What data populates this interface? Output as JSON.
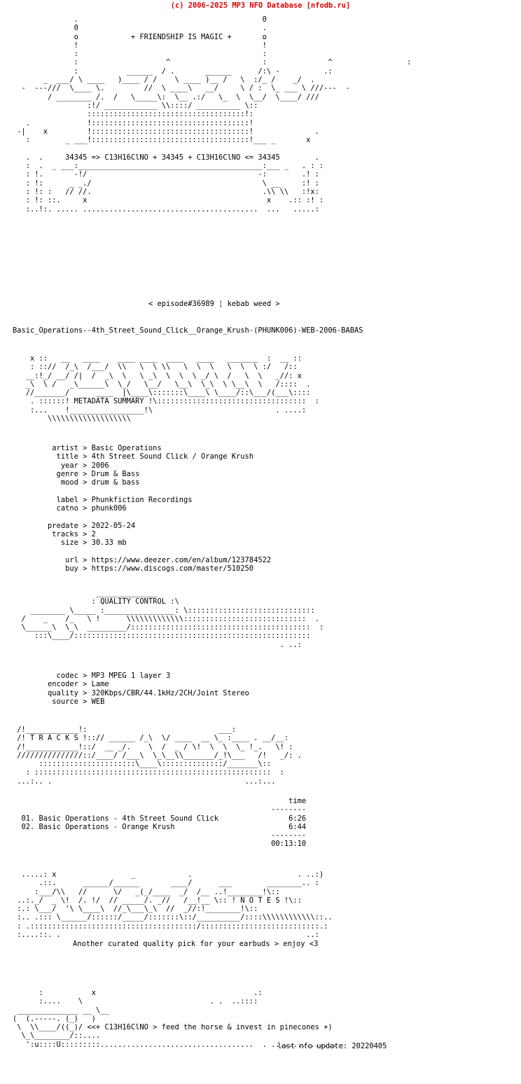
{
  "page": {
    "copyright": "(c) 2006-2025 MP3 NFO Database [nfodb.ru]",
    "copyright_color": "#e00000",
    "background_color": "#ffffff",
    "text_color": "#000000"
  },
  "header": {
    "tagline": "+ FRIENDSHIP IS MAGIC +",
    "formula_line": "34345 => C13H16ClNO + 34345 + C13H16ClNO <= 34345",
    "episode_line": "< episode#36989 ¦ kebab weed >",
    "release_name": "Basic_Operations--4th_Street_Sound_Click__Orange_Krush-(PHUNK006)-WEB-2006-BABAS",
    "ascii_art": "              .                                          0\n              0                                          .\n              o            + FRIENDSHIP IS MAGIC +       o\n              !                                          !\n              :                                          :\n              :                    ^                     :              ^                 :\n              :           ______  / .       ______      /:\\ -          .:\n       _  ___/ \\ ____   )____ / /    \\ ____ )__ /   \\  :/_ /    _/  .\n  -  ---///  \\____ \\.         //  \\ ____\\   __/     \\ / :  \\_ ___ \\ ///---  -\n        / ________ /.  /   \\_____\\:  \\__ .:/   \\_  \\  \\__/  \\____/ ///\n                 :!/ ____________ \\\\::::/ __________ \\::\n                 ::::::::::::::::::::::::::::::::::::!:\n   .             !::::::::::::::::::::::::::::::::::::!\n -|    x         !::::::::::::::::::::::::::::::::::::!              .\n   :        _ ___!::::::::::::::::::::::::::::::::::::!___ _       x\n\n   .  .     34345 => C13H16ClNO + 34345 + C13H16ClNO <= 34345        .\n   :  .  _ ___:__________________________________________:___ _   . : :\n   : !.       -!/                                       -:        .! :\n   : !:      _ _./                                       \\ __     :! :\n   : !: :   // //.                                       .\\\\ \\\\   :!x:\n   : !: ::.     x                                         x    .:: :! :\n   :..!:. ..... ........................................  ...   .....:"
  },
  "metadata_banner": {
    "label": "METADATA SUMMARY",
    "ascii_art": "    x ::   __   ____    ____ ____  ____   ____   _______  :  __ ::\n    : :://  /_\\  /___/  \\\\   \\  \\ \\\\   \\  \\  \\   \\  \\  \\ :/   /::\n   __:!_/ __/ /|  /  _\\  \\   \\ _\\  \\  \\  \\ _/ \\  /   \\  \\   _//: x\n   _\\  \\ /   _\\______\\  \\_/   \\__/   \\__\\  \\_\\  \\ \\__\\  \\   /::::  .\n   //_______/      ____  |\\____\\:::::::\\____\\ \\____/::\\___/(___\\::::\n    . ::::::! METADATA SUMMARY !\\::::::::::::::::::::::::::::::::::  :\n    :...    !_________________!\\                            . ....:\n        \\\\\\\\\\\\\\\\\\\\\\\\\\\\\\\\\\\\\\"
  },
  "metadata": {
    "fields": [
      {
        "key": "artist",
        "value": "Basic Operations"
      },
      {
        "key": "title",
        "value": "4th Street Sound Click / Orange Krush"
      },
      {
        "key": "year",
        "value": "2006"
      },
      {
        "key": "genre",
        "value": "Drum & Bass"
      },
      {
        "key": "mood",
        "value": "drum & bass"
      },
      {
        "key": "",
        "value": ""
      },
      {
        "key": "label",
        "value": "Phunkfiction Recordings"
      },
      {
        "key": "catno",
        "value": "phunk006"
      },
      {
        "key": "",
        "value": ""
      },
      {
        "key": "predate",
        "value": "2022-05-24"
      },
      {
        "key": "tracks",
        "value": "2"
      },
      {
        "key": "size",
        "value": "30.33 mb"
      },
      {
        "key": "",
        "value": ""
      },
      {
        "key": "url",
        "value": "https://www.deezer.com/en/album/123784522"
      },
      {
        "key": "buy",
        "value": "https://www.discogs.com/master/510250"
      }
    ],
    "rendered": "         artist > Basic Operations\n          title > 4th Street Sound Click / Orange Krush\n           year > 2006\n          genre > Drum & Bass\n           mood > drum & bass\n\n          label > Phunkfiction Recordings\n          catno > phunk006\n\n        predate > 2022-05-24\n         tracks > 2\n           size > 30.33 mb\n\n            url > https://www.deezer.com/en/album/123784522\n            buy > https://www.discogs.com/master/510250"
  },
  "quality_banner": {
    "label": "QUALITY CONTROL",
    "ascii_art": "                   ______________\n                  : QUALITY CONTROL :\\\n    ________ \\_____ :________________: \\:::::::::::::::::::::::::::::\n  /    _    /_   \\ !      \\\\\\\\\\\\\\\\\\\\\\\\\\::::::::::::::::::::::::::::  .\n  \\______\\  \\_\\  _________/:::::::::::::::::::::::::::::::::::::::::  :\n     :::\\____/::::::::::::::::::::::::::::::::::::::::::::::::::::::\n                                                             . ..:"
  },
  "quality": {
    "fields": [
      {
        "key": "codec",
        "value": "MP3 MPEG 1 layer 3"
      },
      {
        "key": "encoder",
        "value": "Lame"
      },
      {
        "key": "quality",
        "value": "320Kbps/CBR/44.1kHz/2CH/Joint Stereo"
      },
      {
        "key": "source",
        "value": "WEB"
      }
    ],
    "rendered": "          codec > MP3 MPEG 1 layer 3\n        encoder > Lame\n        quality > 320Kbps/CBR/44.1kHz/2CH/Joint Stereo\n         source > WEB"
  },
  "tracks_banner": {
    "label": "T R A C K S",
    "ascii_art": " /!____________!:                              ___:\n /! T R A C K S !::// ______ /_\\  \\/ ____  __ \\_ :____ . __/__:\n /!____________!::/  __ _/.    \\  /  _ / \\!  \\  \\  \\_ !_.   \\! :\n ///////////////::/____/ /___\\  \\_\\__\\\\_______/_!\\___   /!   _/: .\n      ::::::::::::::::::::::\\____\\::::::::::::::/_______\\::\n   : ::::::::::::::::::::::::::::::::::::::::::::::::::::::  :\n ...:.. .                                            ...:..."
  },
  "tracklist": {
    "time_header": "time",
    "divider": "--------",
    "items": [
      {
        "num": "01.",
        "artist": "Basic Operations",
        "title": "4th Street Sound Click",
        "time": "6:26"
      },
      {
        "num": "02.",
        "artist": "Basic Operations",
        "title": "Orange Krush",
        "time": "6:44"
      }
    ],
    "total_time": "00:13:10",
    "rendered": "                                                               time\n                                                           --------\n  01. Basic Operations - 4th Street Sound Click                6:26\n  02. Basic Operations - Orange Krush                          6:44\n                                                           --------\n                                                           00:13:10"
  },
  "notes_banner": {
    "label": "N O T E S",
    "ascii_art": "  .....: x                 _            .                        . ..:)\n      .::.      ______/______       ____/      ___        ________.. :\n     :___/\\\\   //      \\/   _(_/____  _/  /__ ..!________!\\::\n ..:._/  _ \\!  /. !/  // _____/. _//   /__!__ \\:: ! N O T E S !\\::\n :.: \\___/  '\\ \\____\\  //_\\___\\_\\  //  _//:!________!\\::\n :.. .::: \\______/::::::/_____/:::::::\\::/__________/::::\\\\\\\\\\\\\\\\\\\\\\\\::..\n : .::::::::::::::::::::::::::::::::::::::/:::::::::::::::::::::::::::.:\n :....::. .                                                        ..:",
    "note_text": "Another curated quality pick for your earbuds > enjoy <3"
  },
  "footer": {
    "signature_line": "<<+ C13H16ClNO > feed the horse & invest in pinecones +)",
    "last_update_label": "last nfo update:",
    "last_update_value": "20220405",
    "last_update_line": "last nfo update: 20220405",
    "ascii_art": "      :           x                                    .:\n      :....    \\                             . .  ..::::\n ______________ __ \\__\n(  (.-----. (_)   )\n \\  \\\\____/((_)/ <<+ C13H16ClNO > feed the horse & invest in pinecones +)\n  \\_\\________/::....\n   ':u::::U:::::::::...................................  . ..............."
  }
}
